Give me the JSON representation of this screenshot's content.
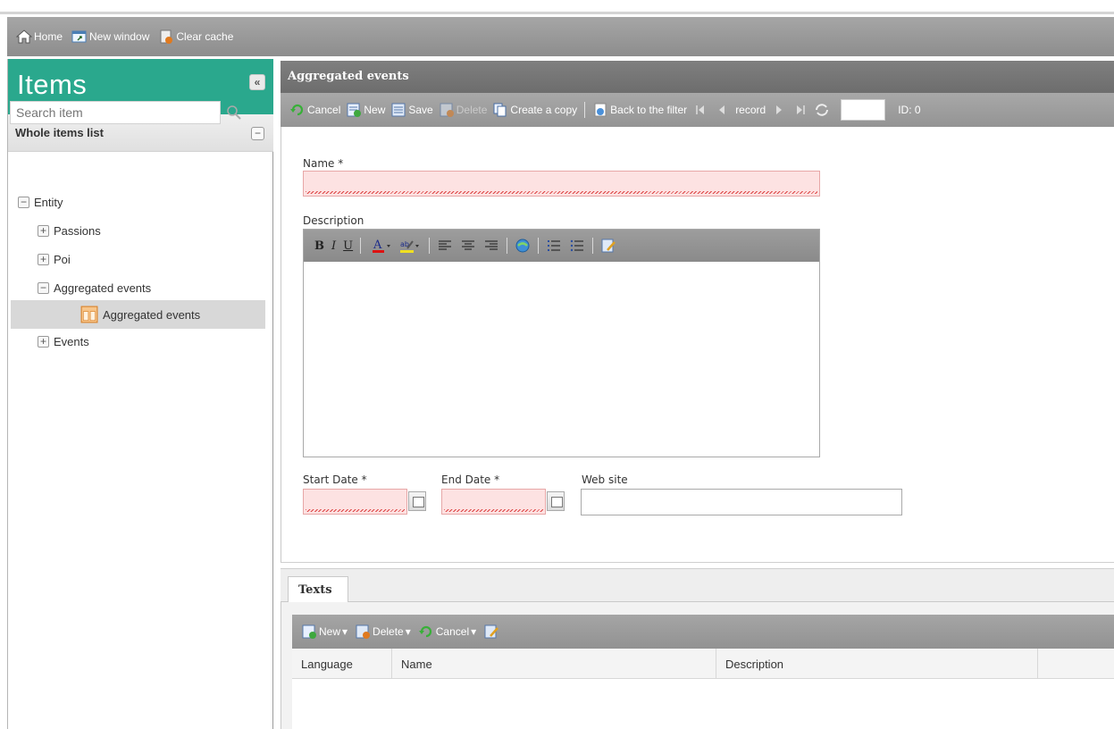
{
  "topbar": {
    "home": "Home",
    "new_window": "New window",
    "clear_cache": "Clear cache"
  },
  "sidebar": {
    "title": "Items",
    "collapse_glyph": "«",
    "list_title": "Whole items list",
    "toggle_glyph": "−",
    "search_placeholder": "Search item",
    "tree": [
      {
        "label": "Entity",
        "expander": "−"
      },
      {
        "label": "Passions",
        "expander": "+"
      },
      {
        "label": "Poi",
        "expander": "+"
      },
      {
        "label": "Aggregated events",
        "expander": "−"
      },
      {
        "label": "Aggregated events",
        "expander": ""
      },
      {
        "label": "Events",
        "expander": "+"
      }
    ]
  },
  "main": {
    "title": "Aggregated events",
    "toolbar": {
      "cancel": "Cancel",
      "new": "New",
      "save": "Save",
      "delete": "Delete",
      "copy": "Create a copy",
      "back": "Back to the filter",
      "record": "record",
      "id_label": "ID: 0"
    },
    "form": {
      "name_label": "Name *",
      "name_value": "",
      "description_label": "Description",
      "start_date_label": "Start Date *",
      "end_date_label": "End Date *",
      "website_label": "Web site",
      "website_value": ""
    },
    "editor_buttons": [
      "B",
      "I",
      "U"
    ]
  },
  "texts": {
    "tab_label": "Texts",
    "toolbar": {
      "new": "New",
      "delete": "Delete",
      "cancel": "Cancel"
    },
    "columns": [
      "Language",
      "Name",
      "Description"
    ]
  },
  "colors": {
    "sidebar_header": "#2aa88d",
    "toolbar_gray": "#9a9a9a",
    "error_field": "#fde2e2"
  }
}
